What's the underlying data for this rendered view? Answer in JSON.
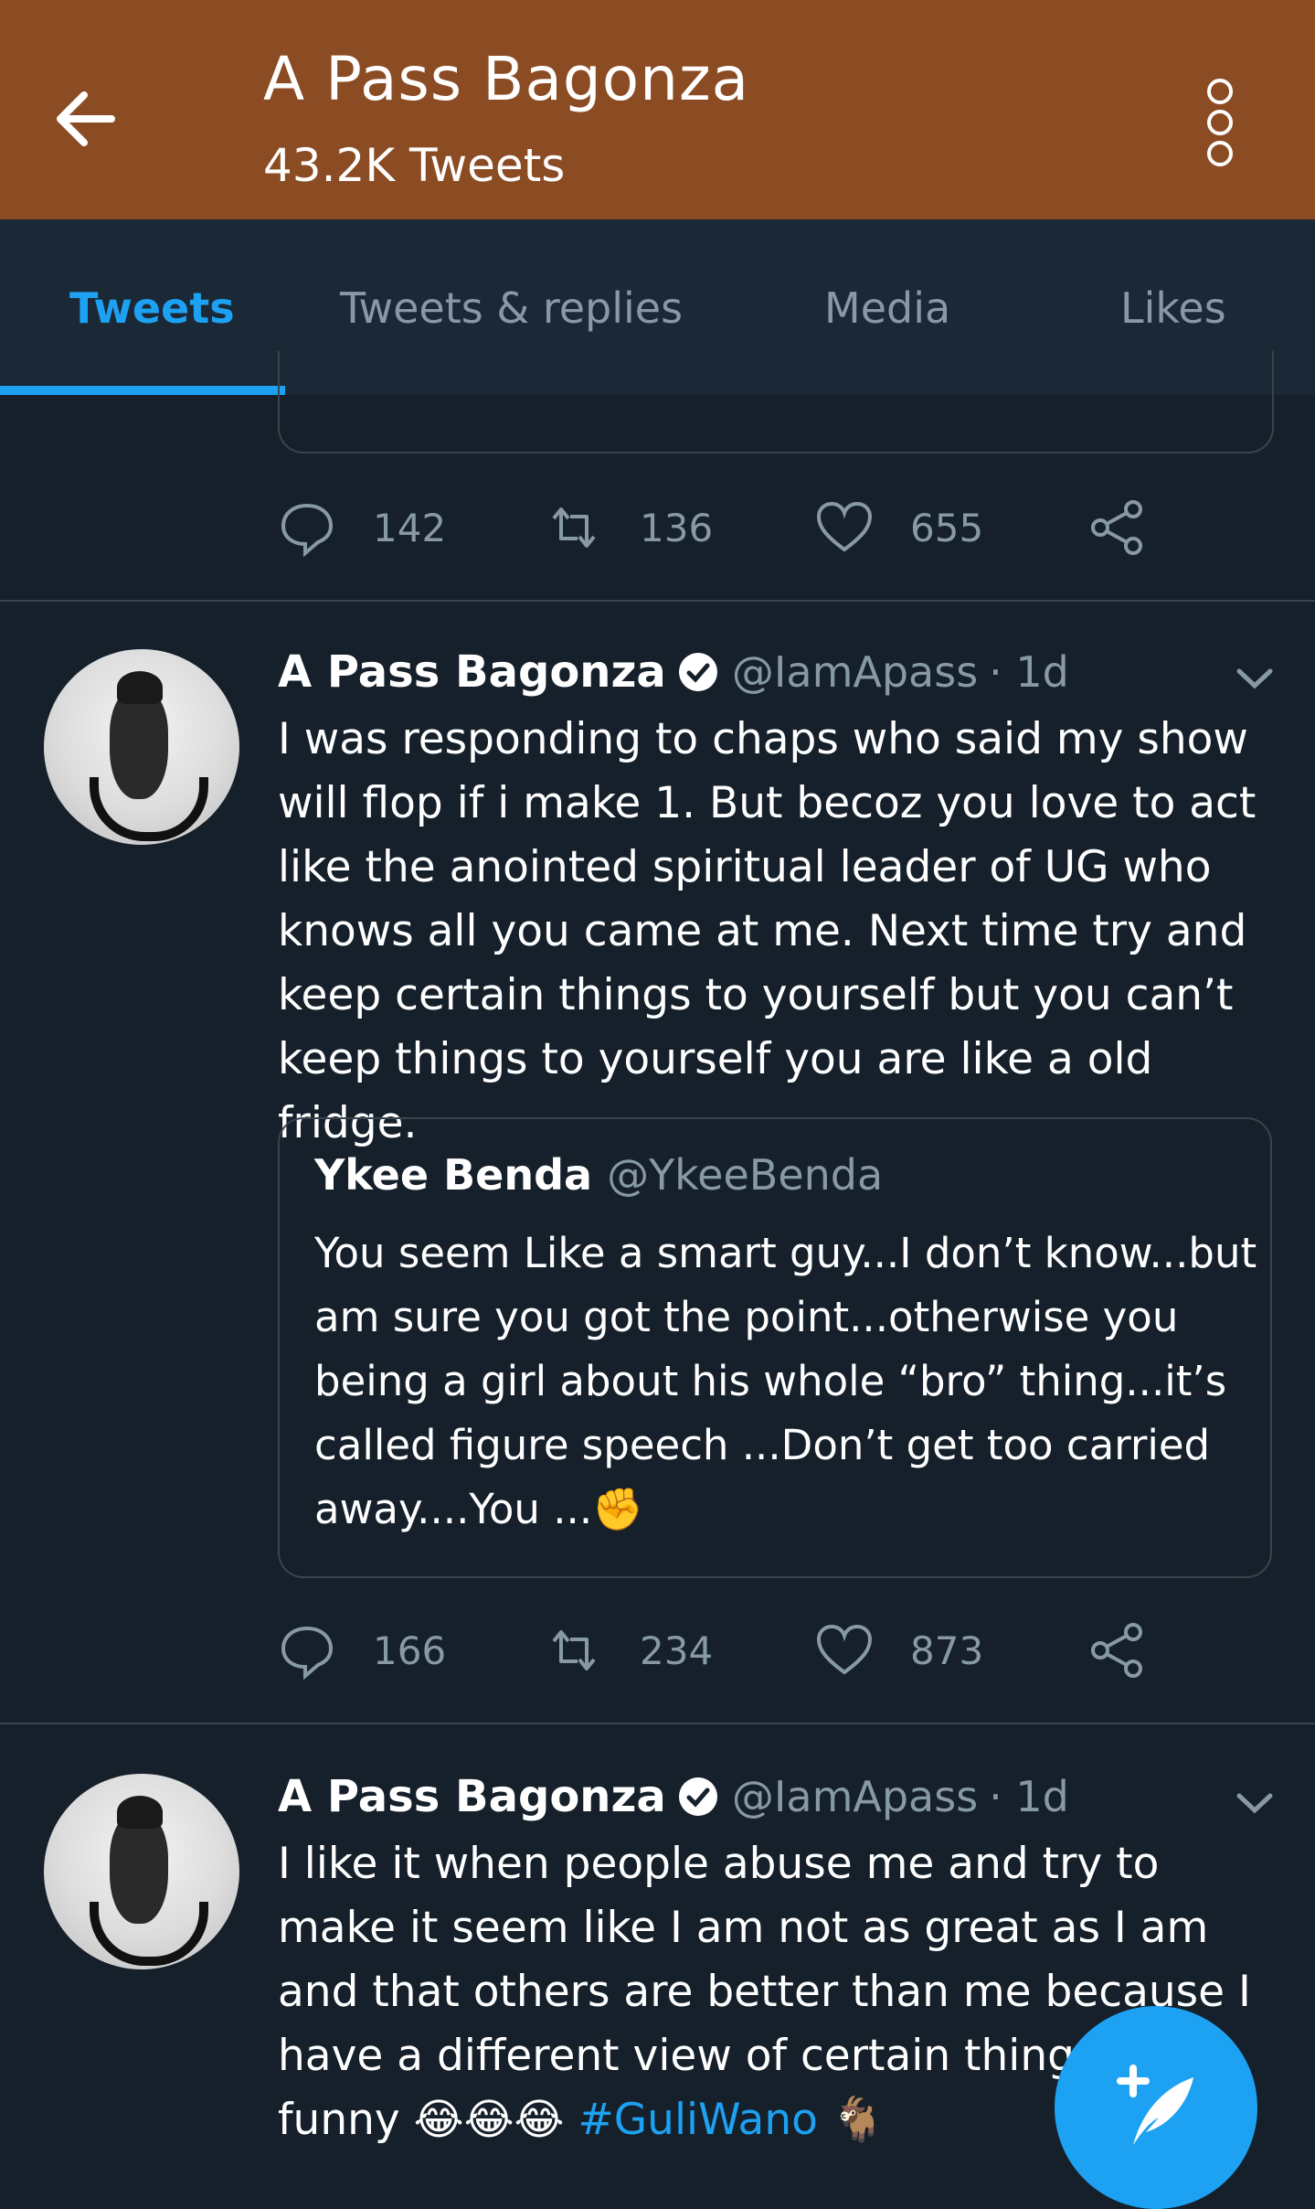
{
  "header": {
    "title": "A Pass Bagonza",
    "subtitle": "43.2K Tweets"
  },
  "tabs": [
    {
      "label": "Tweets",
      "active": true
    },
    {
      "label": "Tweets & replies",
      "active": false
    },
    {
      "label": "Media",
      "active": false
    },
    {
      "label": "Likes",
      "active": false
    }
  ],
  "colors": {
    "header_bg": "#8b4c24",
    "background": "#15202b",
    "accent": "#1da1f2",
    "muted": "#8899a6"
  },
  "tweets": [
    {
      "stats": {
        "replies": "142",
        "retweets": "136",
        "likes": "655"
      }
    },
    {
      "name": "A Pass Bagonza",
      "handle": "@IamApass",
      "time": "· 1d",
      "text": "I was responding to chaps who said my show will flop if i make 1. But becoz you love to act like the anointed spiritual leader of UG who knows all you came at me. Next time try and keep certain things to yourself but you can’t keep things to yourself you are like a old fridge.",
      "quote": {
        "name": "Ykee Benda",
        "handle": "@YkeeBenda",
        "text": "You seem Like a smart guy...I don’t know...but am sure you got the point...otherwise you being a girl about his whole “bro” thing...it’s called figure speech ...Don’t get too carried away....You ...✊"
      },
      "stats": {
        "replies": "166",
        "retweets": "234",
        "likes": "873"
      }
    },
    {
      "name": "A Pass Bagonza",
      "handle": "@IamApass",
      "time": "· 1d",
      "text": "I like it when people abuse me and try to make it seem like I am not as great as I am and that others are better than me because I have a different view of certain things, that funny 😂😂😂",
      "hashtag": "#GuliWano",
      "trailing_emoji": "🐐"
    }
  ],
  "icons": {
    "back": "arrow-left-icon",
    "more": "vertical-dots-icon",
    "reply": "comment-bubble-icon",
    "retweet": "retweet-icon",
    "like": "heart-icon",
    "share": "share-icon",
    "verified": "verified-badge-icon",
    "compose": "compose-feather-icon"
  }
}
